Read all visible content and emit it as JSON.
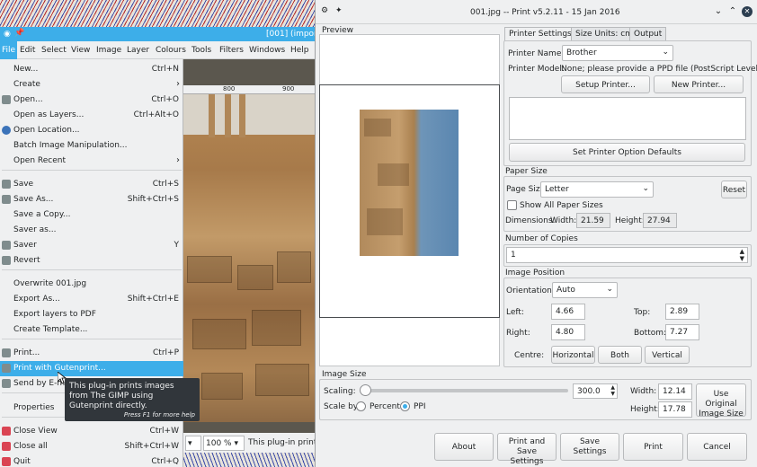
{
  "gimp": {
    "title": "[001] (import",
    "menubar": [
      "File",
      "Edit",
      "Select",
      "View",
      "Image",
      "Layer",
      "Colours",
      "Tools",
      "Filters",
      "Windows",
      "Help"
    ],
    "ruler": [
      "800",
      "900"
    ],
    "file_menu": [
      {
        "label": "New...",
        "shortcut": "Ctrl+N"
      },
      {
        "label": "Create",
        "shortcut": ""
      },
      {
        "label": "Open...",
        "shortcut": "Ctrl+O"
      },
      {
        "label": "Open as Layers...",
        "shortcut": "Ctrl+Alt+O"
      },
      {
        "label": "Open Location...",
        "shortcut": ""
      },
      {
        "label": "Batch Image Manipulation...",
        "shortcut": ""
      },
      {
        "label": "Open Recent",
        "shortcut": ""
      },
      {
        "label": "Save",
        "shortcut": "Ctrl+S"
      },
      {
        "label": "Save As...",
        "shortcut": "Shift+Ctrl+S"
      },
      {
        "label": "Save a Copy...",
        "shortcut": ""
      },
      {
        "label": "Saver as...",
        "shortcut": ""
      },
      {
        "label": "Saver",
        "shortcut": "Y"
      },
      {
        "label": "Revert",
        "shortcut": ""
      },
      {
        "label": "Overwrite 001.jpg",
        "shortcut": ""
      },
      {
        "label": "Export As...",
        "shortcut": "Shift+Ctrl+E"
      },
      {
        "label": "Export layers to PDF",
        "shortcut": ""
      },
      {
        "label": "Create Template...",
        "shortcut": ""
      },
      {
        "label": "Print...",
        "shortcut": "Ctrl+P"
      },
      {
        "label": "Print with Gutenprint...",
        "shortcut": ""
      },
      {
        "label": "Send by E-mail",
        "shortcut": ""
      },
      {
        "label": "Properties",
        "shortcut": ""
      },
      {
        "label": "Close View",
        "shortcut": "Ctrl+W"
      },
      {
        "label": "Close all",
        "shortcut": "Shift+Ctrl+W"
      },
      {
        "label": "Quit",
        "shortcut": "Ctrl+Q"
      }
    ],
    "tooltip": {
      "text": "This plug-in prints images from The GIMP using Gutenprint directly.",
      "hint": "Press F1 for more help"
    },
    "status": {
      "zoom": "100 %",
      "message": "This plug-in prints"
    }
  },
  "dialog": {
    "title": "001.jpg -- Print v5.2.11 - 15 Jan 2016",
    "preview_label": "Preview",
    "tabs": [
      "Printer Settings",
      "Size Units: cm",
      "Output"
    ],
    "printer_name_label": "Printer Name:",
    "printer_name": "Brother",
    "printer_model_label": "Printer Model:",
    "printer_model": "None; please provide a PPD file (PostScript Level 2)",
    "setup_printer": "Setup Printer...",
    "new_printer": "New Printer...",
    "set_defaults": "Set Printer Option Defaults",
    "paper_size": {
      "group": "Paper Size",
      "label": "Page Size",
      "value": "Letter",
      "reset": "Reset",
      "show_all": "Show All Paper Sizes",
      "dimensions_label": "Dimensions:",
      "width_label": "Width:",
      "width": "21.59",
      "height_label": "Height:",
      "height": "27.94"
    },
    "copies": {
      "group": "Number of Copies",
      "value": "1"
    },
    "position": {
      "group": "Image Position",
      "orientation_label": "Orientation:",
      "orientation": "Auto",
      "left_label": "Left:",
      "left": "4.66",
      "top_label": "Top:",
      "top": "2.89",
      "right_label": "Right:",
      "right": "4.80",
      "bottom_label": "Bottom:",
      "bottom": "7.27",
      "centre_label": "Centre:",
      "horizontal": "Horizontal",
      "both": "Both",
      "vertical": "Vertical"
    },
    "image_size": {
      "group": "Image Size",
      "scaling_label": "Scaling:",
      "scaling": "300.0",
      "scaling_fraction": 0.0,
      "scale_by_label": "Scale by:",
      "percent": "Percent",
      "ppi": "PPI",
      "width_label": "Width:",
      "width": "12.14",
      "height_label": "Height:",
      "height": "17.78",
      "use_original": "Use Original Image Size"
    },
    "buttons": {
      "about": "About",
      "print_and_save": "Print and Save Settings",
      "save_settings": "Save Settings",
      "print": "Print",
      "cancel": "Cancel"
    },
    "colors": {
      "accent": "#3daee9",
      "window": "#eff0f1"
    }
  }
}
